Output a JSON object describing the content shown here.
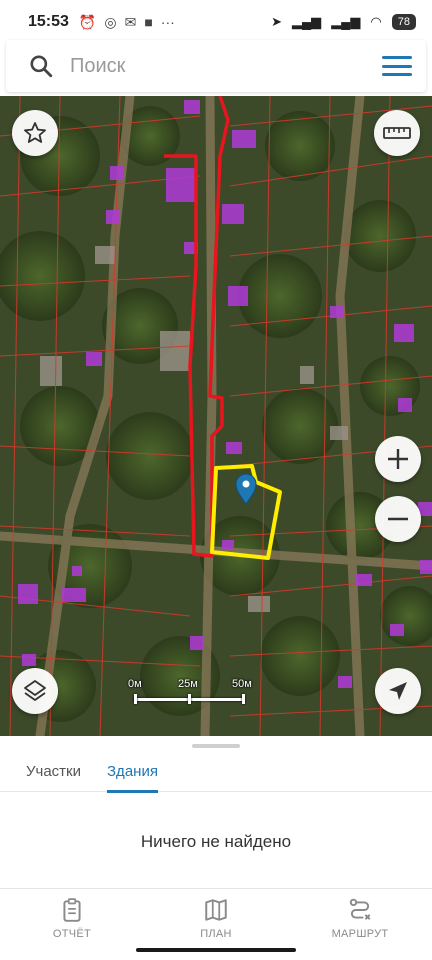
{
  "status_bar": {
    "time": "15:53",
    "battery": "78",
    "icons_left": [
      "alarm-icon",
      "whatsapp-icon",
      "mail-icon",
      "app-icon",
      "more-dots-icon"
    ],
    "more": "···"
  },
  "search": {
    "placeholder": "Поиск",
    "value": ""
  },
  "map": {
    "scale_labels": [
      "0м",
      "25м",
      "50м"
    ]
  },
  "sheet": {
    "tabs": [
      {
        "label": "Участки",
        "active": false
      },
      {
        "label": "Здания",
        "active": true
      }
    ],
    "empty_message": "Ничего не найдено"
  },
  "bottom_nav": {
    "items": [
      {
        "label": "ОТЧЁТ",
        "icon": "clipboard-icon"
      },
      {
        "label": "ПЛАН",
        "icon": "map-icon"
      },
      {
        "label": "МАРШРУТ",
        "icon": "route-icon"
      }
    ]
  },
  "colors": {
    "accent": "#1f78b4",
    "selected_parcel": "#ffee00",
    "route_outline": "#e8141e",
    "cadastre_lines": "#d23a2a",
    "buildings": "#b03ad8"
  }
}
